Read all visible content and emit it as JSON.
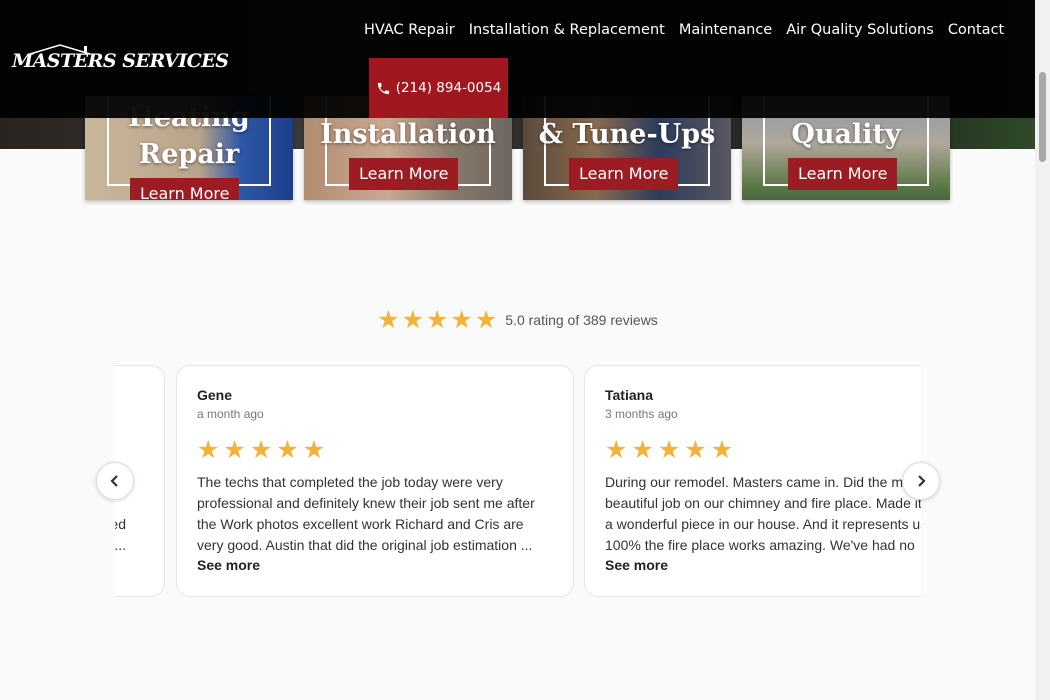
{
  "header": {
    "logo_text": "MASTERS SERVICES",
    "nav": [
      {
        "label": "HVAC Repair"
      },
      {
        "label": "Installation & Replacement"
      },
      {
        "label": "Maintenance"
      },
      {
        "label": "Air Quality Solutions"
      },
      {
        "label": "Contact"
      }
    ],
    "phone": "(214) 894-0054"
  },
  "service_cards": [
    {
      "title_line1": "Heating",
      "title_line2": "Repair",
      "cta": "Learn More"
    },
    {
      "title_line1": "Installation",
      "cta": "Learn More"
    },
    {
      "title_line1": "& Tune-Ups",
      "cta": "Learn More"
    },
    {
      "title_line1": "Quality",
      "cta": "Learn More"
    }
  ],
  "rating": {
    "stars": 5,
    "star_glyph": "★",
    "text": "5.0 rating of 389 reviews"
  },
  "reviews": {
    "previous_snippet_line1": "ed",
    "previous_snippet_line2": "...",
    "items": [
      {
        "name": "Gene",
        "date": "a month ago",
        "text": "The techs that completed the job today were very professional and definitely knew their job sent me after the Work photos excellent work Richard and Cris are very good.  Austin that did the original job estimation ...",
        "see_more": "See more"
      },
      {
        "name": "Tatiana",
        "date": "3 months ago",
        "text": "During our remodel. Masters came in. Did the most beautiful job on our chimney and fire place. Made it such a wonderful piece in our house. And it represents us 100% the fire place works amazing. We've had no",
        "see_more": "See more"
      }
    ],
    "prev_arrow": "‹",
    "next_arrow": "›"
  },
  "colors": {
    "accent_red": "#9b1c22",
    "star": "#f2b33d",
    "header_bg": "#000000"
  }
}
